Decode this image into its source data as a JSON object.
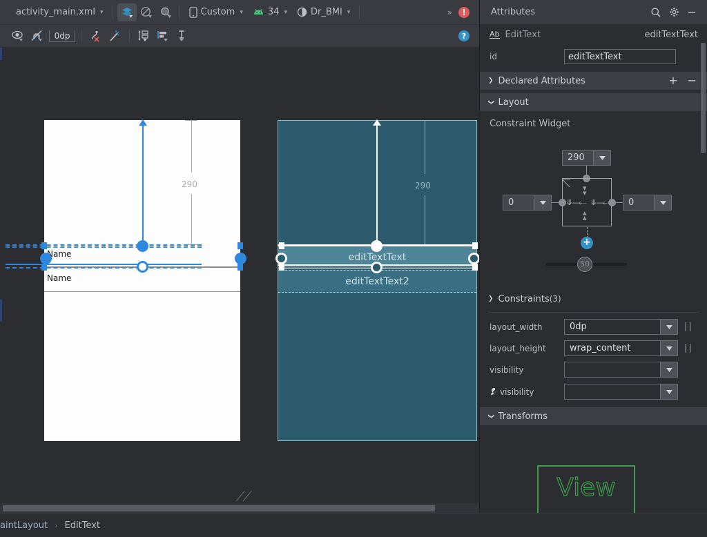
{
  "toolbar": {
    "file_tab": "activity_main.xml",
    "device_label": "Custom",
    "api_level": "34",
    "theme_label": "Dr_BMI",
    "overflow": "»",
    "error_glyph": "!",
    "icons": {
      "design_mode": "layers-icon",
      "blueprint_mode": "blueprint-icon",
      "zoom": "magnifier-icon",
      "device": "phone-icon",
      "api": "android-icon",
      "theme": "theme-contrast-icon"
    }
  },
  "toolbar2": {
    "margin_value": "0dp",
    "help_glyph": "?",
    "icons": {
      "show_constraints": "eye-icon",
      "autoconnect": "magnet-off-icon",
      "default_margin": "margin-icon",
      "clear_constraints": "clear-constraints-icon",
      "infer_constraints": "magic-wand-icon",
      "align_vertical": "align-vertical-icon",
      "align_horizontal": "align-horizontal-icon",
      "guidelines": "guidelines-icon"
    }
  },
  "canvas": {
    "design": {
      "field1_text": "Name",
      "field2_text": "Name",
      "dimension_label": "290"
    },
    "blueprint": {
      "widget1_label": "editTextText",
      "widget2_label": "editTextText2",
      "dimension_label": "290"
    }
  },
  "breadcrumb": {
    "items": [
      "aintLayout",
      "EditText"
    ],
    "separator": "›"
  },
  "attributes": {
    "panel_title": "Attributes",
    "header_icons": [
      "search-icon",
      "gear-icon",
      "minimize-icon"
    ],
    "component_type": "EditText",
    "component_id": "editTextText",
    "type_icon_label": "Ab",
    "id_label": "id",
    "id_value": "editTextText",
    "sections": {
      "declared_attributes": "Declared Attributes",
      "layout": "Layout",
      "constraints": "Constraints",
      "constraints_count": "(3)",
      "transforms": "Transforms"
    },
    "constraint_widget": {
      "title": "Constraint Widget",
      "top_margin": "290",
      "left_margin": "0",
      "right_margin": "0",
      "bias_value": "50",
      "add_glyph": "+"
    },
    "rows": [
      {
        "label": "layout_width",
        "value": "0dp",
        "has_wrench": false,
        "has_paren": true
      },
      {
        "label": "layout_height",
        "value": "wrap_content",
        "has_wrench": false,
        "has_paren": true
      },
      {
        "label": "visibility",
        "value": "",
        "has_wrench": false,
        "has_paren": false
      },
      {
        "label": "visibility",
        "value": "",
        "has_wrench": true,
        "has_paren": false
      }
    ],
    "view_preview_label": "View"
  },
  "colors": {
    "accent_blue": "#2f88e0",
    "blueprint_bg": "#2b5b6d",
    "blueprint_widget": "#4d8498",
    "error_red": "#db5c5c",
    "help_blue": "#3592c4",
    "green": "#3f9e4d",
    "toolbar_bg": "#393b40",
    "panel_bg": "#2b2d30"
  }
}
